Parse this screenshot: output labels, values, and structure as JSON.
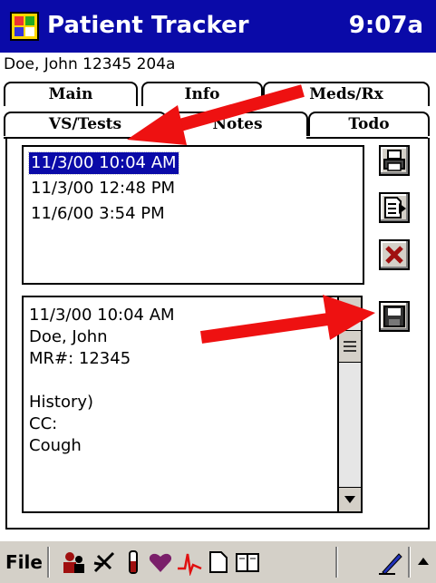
{
  "titlebar": {
    "app_title": "Patient Tracker",
    "clock": "9:07a"
  },
  "patient_line": "Doe, John 12345 204a",
  "tabs": {
    "row1": [
      "Main",
      "Info",
      "Meds/Rx"
    ],
    "row2": [
      "VS/Tests",
      "Notes",
      "Todo"
    ],
    "active": "Notes"
  },
  "notes": {
    "items": [
      "11/3/00 10:04 AM",
      "11/3/00 12:48 PM",
      "11/6/00 3:54 PM"
    ],
    "selected": "11/3/00 10:04 AM"
  },
  "detail": {
    "text": "11/3/00 10:04 AM\nDoe, John\nMR#: 12345\n\nHistory)\nCC:\nCough"
  },
  "buttons": {
    "print": "printer-icon",
    "export": "export-document-icon",
    "delete": "delete-x-icon",
    "save": "save-disk-icon"
  },
  "toolbar": {
    "file_label": "File",
    "icons": [
      "patients-icon",
      "caduceus-icon",
      "test-tube-icon",
      "heart-icon",
      "ecg-icon",
      "document-icon",
      "book-icon",
      "pen-icon",
      "up-arrow-icon"
    ]
  },
  "colors": {
    "titlebar": "#0a0aa8",
    "selection": "#0a0aa8",
    "annotation_arrow": "#ee1111"
  }
}
